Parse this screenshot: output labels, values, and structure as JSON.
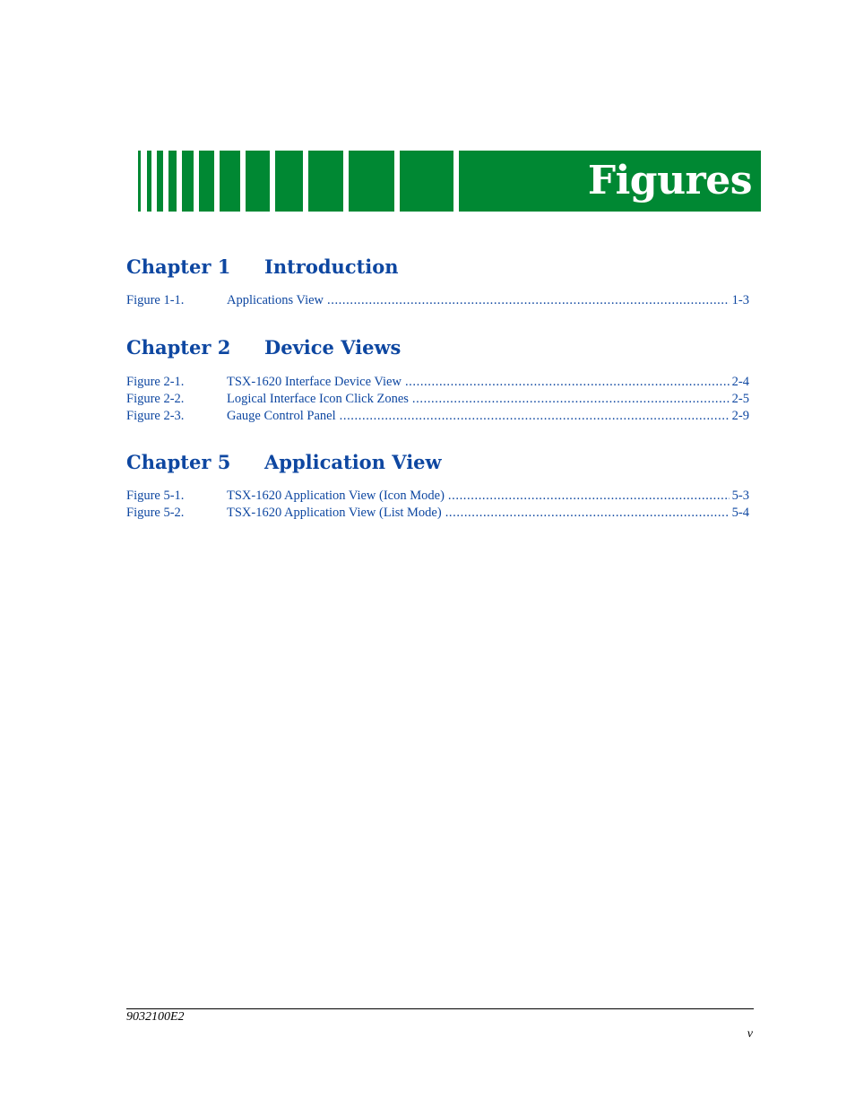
{
  "banner": {
    "title": "Figures",
    "color": "#008833"
  },
  "chapters": [
    {
      "number_label": "Chapter 1",
      "title": "Introduction",
      "figures": [
        {
          "label": "Figure 1-1.",
          "title": "Applications View",
          "page": "1-3"
        }
      ]
    },
    {
      "number_label": "Chapter 2",
      "title": "Device Views",
      "figures": [
        {
          "label": "Figure 2-1.",
          "title": "TSX-1620 Interface Device View",
          "page": "2-4"
        },
        {
          "label": "Figure 2-2.",
          "title": "Logical Interface Icon Click Zones",
          "page": "2-5"
        },
        {
          "label": "Figure 2-3.",
          "title": "Gauge Control Panel",
          "page": "2-9"
        }
      ]
    },
    {
      "number_label": "Chapter 5",
      "title": "Application View",
      "figures": [
        {
          "label": "Figure 5-1.",
          "title": "TSX-1620 Application View (Icon Mode)",
          "page": "5-3"
        },
        {
          "label": "Figure 5-2.",
          "title": "TSX-1620 Application View (List Mode)",
          "page": "5-4"
        }
      ]
    }
  ],
  "footer": {
    "doc_id": "9032100E2",
    "page_number": "v"
  },
  "colors": {
    "link_blue": "#0e47a1",
    "banner_green": "#008833"
  }
}
